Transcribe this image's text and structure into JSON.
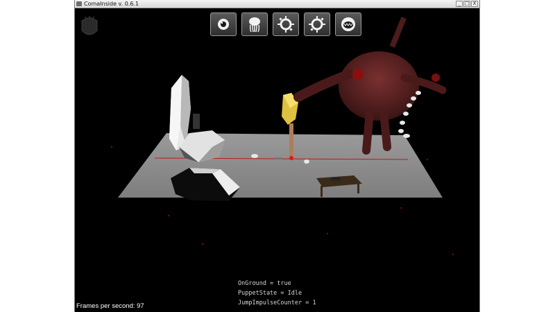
{
  "window": {
    "title": "ComaInside v. 0.6.1",
    "controls": [
      "_",
      "□",
      "X"
    ]
  },
  "toolbar": {
    "tools": [
      {
        "icon": "eye-tool-icon"
      },
      {
        "icon": "jellyfish-tool-icon"
      },
      {
        "icon": "spiked-ring-tool-icon"
      },
      {
        "icon": "spiked-ring-tool-icon"
      },
      {
        "icon": "mouth-tool-icon"
      }
    ]
  },
  "debug": {
    "on_ground": "OnGround = true",
    "puppet_state": "PuppetState = Idle",
    "jump_impulse_counter": "JumpImpulseCounter = 1"
  },
  "fps": {
    "text": "Frames per second: 97"
  },
  "colors": {
    "background": "#000000",
    "floor": "#8a8a8a",
    "creature": "#6a2a2a",
    "crystal": "#e0c040"
  }
}
